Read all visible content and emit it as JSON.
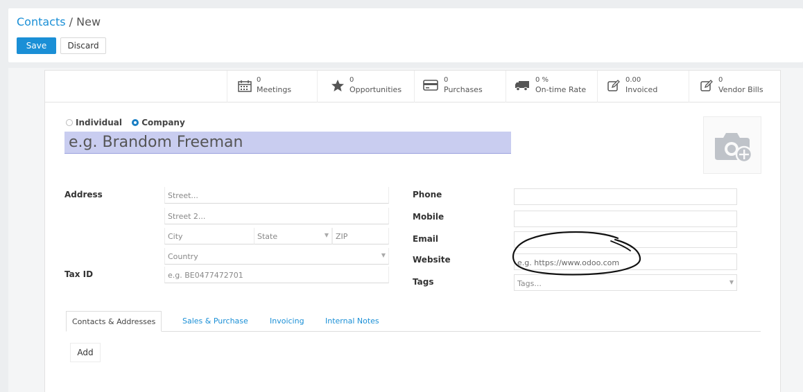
{
  "breadcrumb": {
    "parent": "Contacts",
    "separator": " / ",
    "current": "New"
  },
  "buttons": {
    "save": "Save",
    "discard": "Discard"
  },
  "stats": [
    {
      "icon": "calendar-icon",
      "value": "0",
      "label": "Meetings"
    },
    {
      "icon": "star-icon",
      "value": "0",
      "label": "Opportunities"
    },
    {
      "icon": "credit-card-icon",
      "value": "0",
      "label": "Purchases"
    },
    {
      "icon": "truck-icon",
      "value": "0 %",
      "label": "On-time Rate"
    },
    {
      "icon": "pencil-square-icon",
      "value": "0.00",
      "label": "Invoiced"
    },
    {
      "icon": "pencil-square-icon",
      "value": "0",
      "label": "Vendor Bills"
    }
  ],
  "company_type": {
    "individual": "Individual",
    "company": "Company",
    "selected": "company"
  },
  "name_placeholder": "e.g. Brandom Freeman",
  "address": {
    "label": "Address",
    "street": "Street...",
    "street2": "Street 2...",
    "city": "City",
    "state": "State",
    "zip": "ZIP",
    "country": "Country"
  },
  "tax": {
    "label": "Tax ID",
    "placeholder": "e.g. BE0477472701"
  },
  "contact": {
    "phone_label": "Phone",
    "mobile_label": "Mobile",
    "email_label": "Email",
    "website_label": "Website",
    "website_placeholder": "e.g. https://www.odoo.com",
    "tags_label": "Tags",
    "tags_placeholder": "Tags..."
  },
  "tabs": [
    "Contacts & Addresses",
    "Sales & Purchase",
    "Invoicing",
    "Internal Notes"
  ],
  "add_label": "Add",
  "colors": {
    "accent": "#1a8fd6",
    "name_field_bg": "#c9cdf0",
    "annotation": "#111111"
  }
}
